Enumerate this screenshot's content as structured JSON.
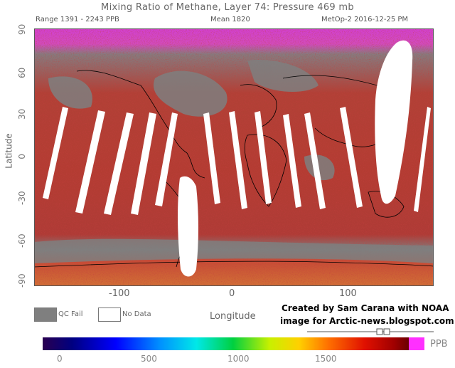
{
  "title": "Mixing Ratio of Methane, Layer 74: Pressure 469 mb",
  "range_label": "Range 1391 - 2243 PPB",
  "mean_label": "Mean 1820",
  "source_label": "MetOp-2 2016-12-25 PM",
  "y_axis_title": "Latitude",
  "y_ticks": [
    "90",
    "60",
    "30",
    "0",
    "-30",
    "-60",
    "-90"
  ],
  "x_axis_title": "Longitude",
  "x_ticks": [
    "-100",
    "0",
    "100"
  ],
  "legend": {
    "qc_fail": "QC Fail",
    "no_data": "No Data"
  },
  "credit_line1": "Created by Sam Carana with NOAA",
  "credit_line2": "image for Arctic-news.blogspot.com",
  "colorbar": {
    "unit": "PPB",
    "ticks": [
      "0",
      "500",
      "1000",
      "1500"
    ]
  },
  "colors": {
    "qc_fail": "#7f7f7f",
    "no_data": "#ffffff",
    "high": "#ff30ff",
    "background": "#ffffff"
  }
}
